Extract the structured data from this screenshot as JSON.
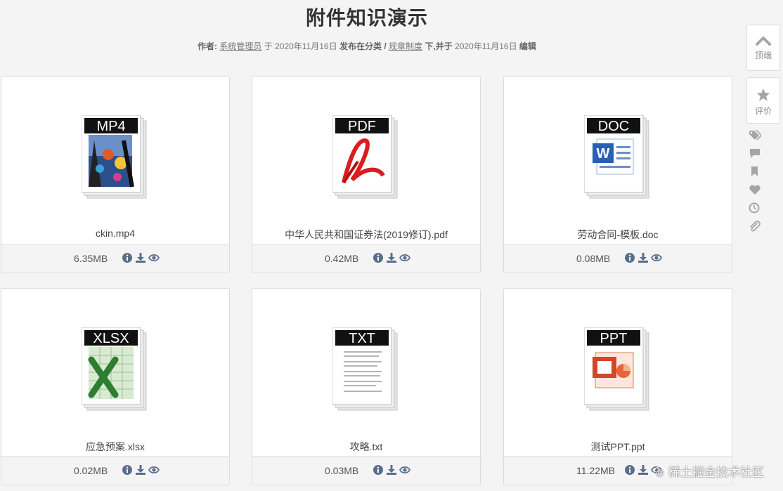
{
  "article": {
    "title": "附件知识演示",
    "meta": {
      "author_label": "作者:",
      "author": "系统管理员",
      "on": "于",
      "publish_date": "2020年11月16日",
      "category_label": "发布在分类",
      "slash": "/",
      "category": "规章制度",
      "under": "下,并于",
      "edit_date": "2020年11月16日",
      "edit_label": "编辑"
    }
  },
  "files": [
    {
      "type": "MP4",
      "name": "ckin.mp4",
      "size": "6.35MB"
    },
    {
      "type": "PDF",
      "name": "中华人民共和国证券法(2019修订).pdf",
      "size": "0.42MB"
    },
    {
      "type": "DOC",
      "name": "劳动合同-模板.doc",
      "size": "0.08MB"
    },
    {
      "type": "XLSX",
      "name": "应急预案.xlsx",
      "size": "0.02MB"
    },
    {
      "type": "TXT",
      "name": "攻略.txt",
      "size": "0.03MB"
    },
    {
      "type": "PPT",
      "name": "测试PPT.ppt",
      "size": "11.22MB"
    }
  ],
  "file_actions": [
    "info-icon",
    "download-icon",
    "eye-icon"
  ],
  "sidebar": {
    "top_label": "顶端",
    "rate_label": "评价",
    "icons": [
      "tags-icon",
      "comment-icon",
      "bookmark-icon",
      "heart-icon",
      "clock-icon",
      "paperclip-icon"
    ]
  },
  "watermark": {
    "symbol": "@",
    "text": "稀土掘金技术社区"
  },
  "colors": {
    "icon": "#5a6e8c",
    "side_icon": "#a5a5a5",
    "title": "#333333"
  }
}
